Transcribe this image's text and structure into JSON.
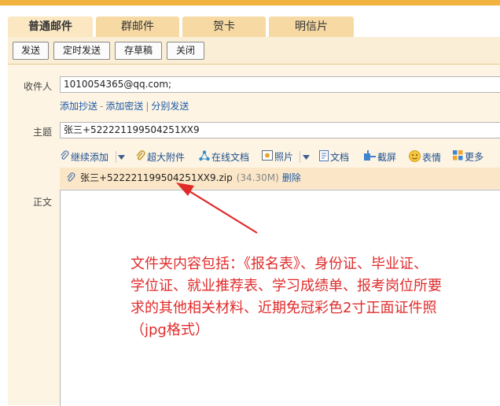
{
  "tabs": [
    "普通邮件",
    "群邮件",
    "贺卡",
    "明信片"
  ],
  "toolbar": {
    "send": "发送",
    "scheduled_send": "定时发送",
    "save_draft": "存草稿",
    "close": "关闭"
  },
  "recipient": {
    "label": "收件人",
    "value": "1010054365@qq.com;"
  },
  "recipient_links": {
    "add_cc": "添加抄送",
    "add_bcc": "添加密送",
    "separate_send": "分别发送"
  },
  "subject": {
    "label": "主题",
    "value": "张三+522221199504251XX9"
  },
  "attach_toolbar": {
    "continue_add": "继续添加",
    "large_attachment": "超大附件",
    "online_doc": "在线文档",
    "photo": "照片",
    "document": "文档",
    "screenshot": "截屏",
    "emoji": "表情",
    "more": "更多"
  },
  "attachment": {
    "filename": "张三+522221199504251XX9.zip",
    "size": "(34.30M)",
    "delete": "删除"
  },
  "body": {
    "label": "正文"
  },
  "annotation": "文件夹内容包括：《报名表》、身份证、毕业证、\n学位证、就业推荐表、学习成绩单、报考岗位所要\n求的其他相关材料、近期免冠彩色2寸正面证件照\n（jpg格式）",
  "colors": {
    "accent_orange": "#f2b23e",
    "annotation_red": "#e02b2b",
    "link_blue": "#1e5aa8"
  }
}
